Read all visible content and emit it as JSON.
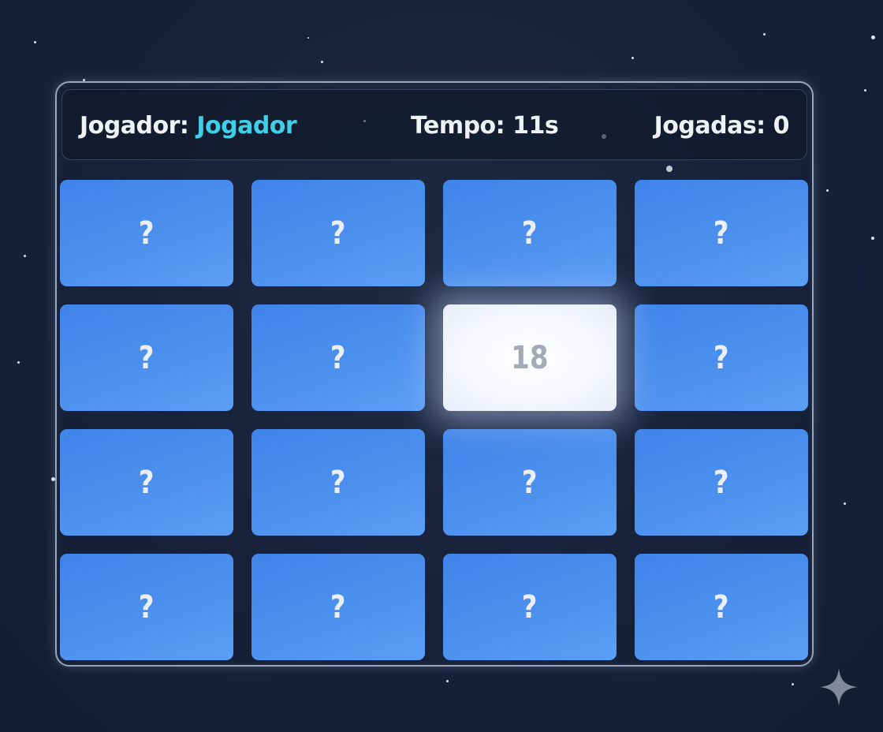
{
  "header": {
    "player_label": "Jogador:",
    "player_name": "Jogador",
    "time_label": "Tempo: 11s",
    "moves_label": "Jogadas: 0"
  },
  "cards": [
    "?",
    "?",
    "?",
    "?",
    "?",
    "?",
    "18",
    "?",
    "?",
    "?",
    "?",
    "?",
    "?",
    "?",
    "?",
    "?"
  ],
  "flipped_index": 6,
  "colors": {
    "background": "#17223a",
    "card_back": "#4b8fee",
    "card_front": "#f5f7fd",
    "accent": "#3fcfe8"
  },
  "icons": {
    "corner": "sparkle-icon"
  }
}
